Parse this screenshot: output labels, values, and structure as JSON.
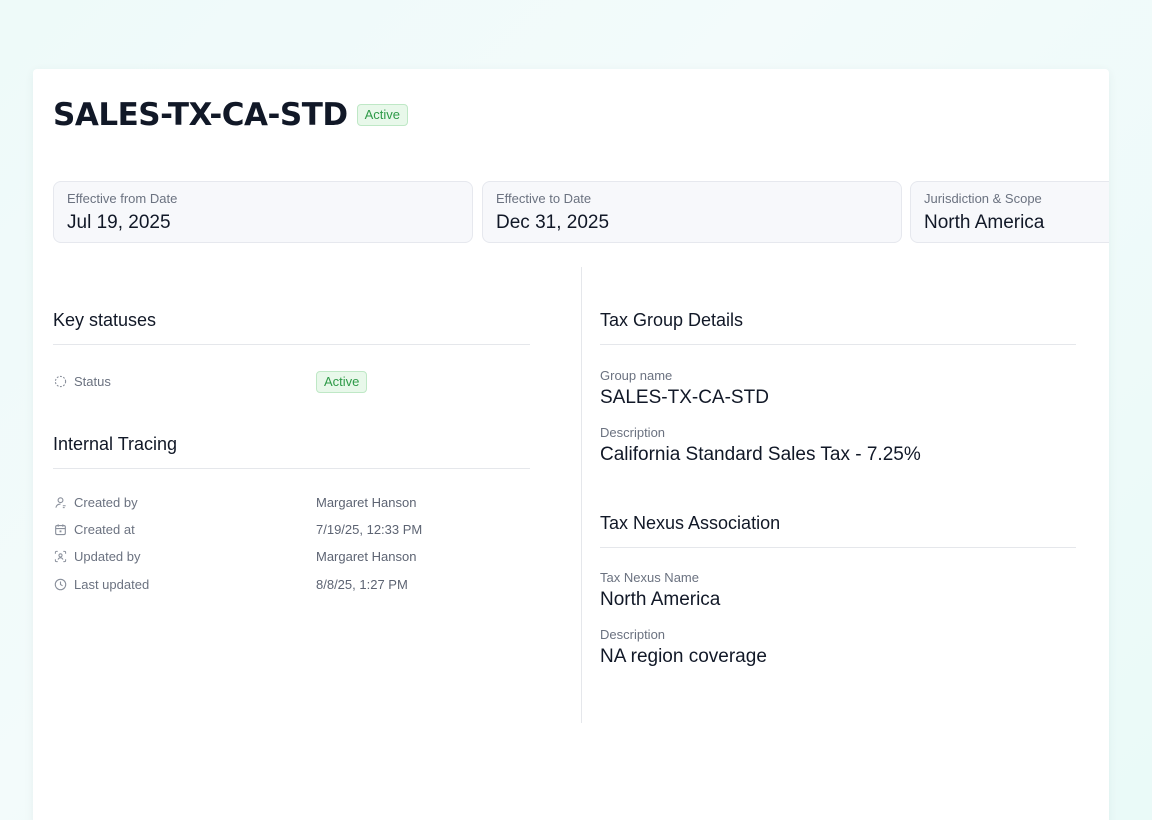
{
  "header": {
    "title": "SALES-TX-CA-STD",
    "status_badge": "Active"
  },
  "summary": [
    {
      "label": "Effective from Date",
      "value": "Jul 19, 2025"
    },
    {
      "label": "Effective to Date",
      "value": "Dec 31, 2025"
    },
    {
      "label": "Jurisdiction & Scope",
      "value": "North America"
    }
  ],
  "key_statuses": {
    "title": "Key statuses",
    "status_label": "Status",
    "status_value": "Active",
    "status_icon": "dashed-circle-icon"
  },
  "internal_tracing": {
    "title": "Internal Tracing",
    "rows": [
      {
        "label": "Created by",
        "value": "Margaret Hanson",
        "icon": "user-icon"
      },
      {
        "label": "Created at",
        "value": "7/19/25, 12:33 PM",
        "icon": "calendar-icon"
      },
      {
        "label": "Updated by",
        "value": "Margaret Hanson",
        "icon": "user-scan-icon"
      },
      {
        "label": "Last updated",
        "value": "8/8/25, 1:27 PM",
        "icon": "clock-icon"
      }
    ]
  },
  "tax_group": {
    "title": "Tax Group Details",
    "group_name_label": "Group name",
    "group_name": "SALES-TX-CA-STD",
    "description_label": "Description",
    "description": "California Standard Sales Tax - 7.25%"
  },
  "tax_nexus": {
    "title": "Tax Nexus Association",
    "name_label": "Tax Nexus Name",
    "name": "North America",
    "description_label": "Description",
    "description": "NA region coverage"
  },
  "colors": {
    "badge_bg": "#e8f8ea",
    "badge_text": "#2e9a48",
    "card_bg": "#f7f8fb",
    "page_bg": "#eefaf9"
  }
}
